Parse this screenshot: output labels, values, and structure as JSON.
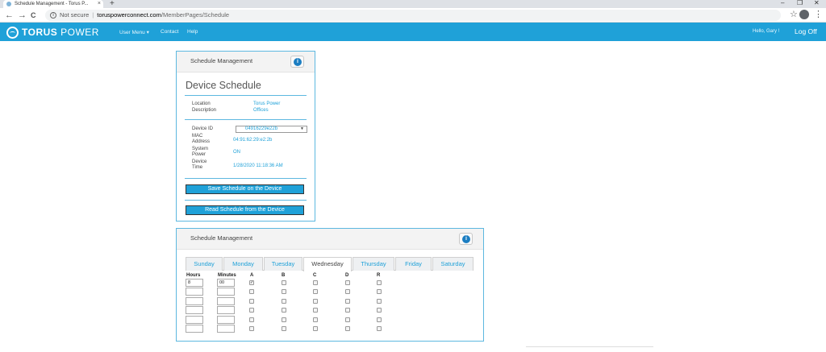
{
  "browser": {
    "tab_title": "Schedule Management - Torus P...",
    "tab_close": "×",
    "new_tab": "+",
    "win_minimize": "–",
    "win_restore": "❐",
    "win_close": "✕",
    "back": "←",
    "forward": "→",
    "reload": "C",
    "info": "i",
    "not_secure": "Not secure",
    "separator": "|",
    "url_host": "toruspowerconnect.com",
    "url_path": "/MemberPages/Schedule",
    "star": "☆",
    "kebab": "⋮"
  },
  "navbar": {
    "logo_bold": "TORUS",
    "logo_rest": " POWER",
    "user_menu": "User Menu ▾",
    "contact": "Contact",
    "help": "Help",
    "greeting": "Hello, Gary !",
    "logoff": "Log Off",
    "color": "#1fa1d8"
  },
  "device_panel": {
    "title": "Schedule Management",
    "help_glyph": "i",
    "heading": "Device Schedule",
    "location_label": "Location",
    "location_value": "Torus Power",
    "description_label": "Description",
    "description_value": "Offices",
    "device_id_label": "Device ID",
    "device_id_value": "04916229e22b",
    "device_id_caret": "▼",
    "mac_label": "MAC Address",
    "mac_value": "04:91:62:29:e2:2b",
    "power_label": "System Power",
    "power_value": "ON",
    "time_label": "Device Time",
    "time_value": "1/28/2020 11:18:36 AM",
    "save_button": "Save Schedule on the Device",
    "read_button": "Read Schedule from the Device"
  },
  "schedule_panel": {
    "title": "Schedule Management",
    "help_glyph": "i",
    "days": [
      "Sunday",
      "Monday",
      "Tuesday",
      "Wednesday",
      "Thursday",
      "Friday",
      "Saturday"
    ],
    "active_day": "Wednesday",
    "columns": {
      "hours": "Hours",
      "minutes": "Minutes",
      "a": "A",
      "b": "B",
      "c": "C",
      "d": "D",
      "r": "R"
    },
    "rows": [
      {
        "hours": "8",
        "minutes": "00",
        "a": "✓",
        "b": "",
        "c": "",
        "d": "",
        "r": ""
      },
      {
        "hours": "",
        "minutes": "",
        "a": "",
        "b": "",
        "c": "",
        "d": "",
        "r": ""
      },
      {
        "hours": "",
        "minutes": "",
        "a": "",
        "b": "",
        "c": "",
        "d": "",
        "r": ""
      },
      {
        "hours": "",
        "minutes": "",
        "a": "",
        "b": "",
        "c": "",
        "d": "",
        "r": ""
      },
      {
        "hours": "",
        "minutes": "",
        "a": "",
        "b": "",
        "c": "",
        "d": "",
        "r": ""
      },
      {
        "hours": "",
        "minutes": "",
        "a": "",
        "b": "",
        "c": "",
        "d": "",
        "r": ""
      }
    ]
  }
}
